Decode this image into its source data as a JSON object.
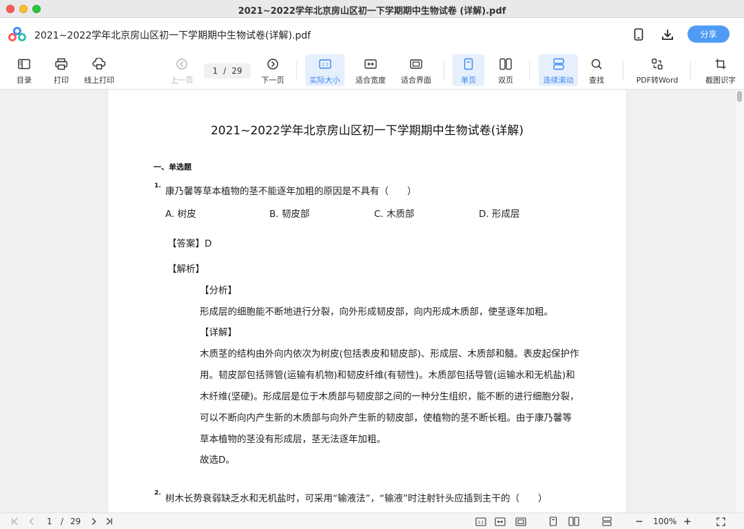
{
  "window": {
    "title": "2021~2022学年北京房山区初一下学期期中生物试卷 (详解).pdf"
  },
  "header": {
    "doc_title": "2021~2022学年北京房山区初一下学期期中生物试卷(详解).pdf",
    "share_label": "分享",
    "icons": [
      "app-logo",
      "phone-icon",
      "download-icon"
    ]
  },
  "toolbar": {
    "toc": "目录",
    "print": "打印",
    "online_print": "线上打印",
    "prev_page": "上一页",
    "current_page": "1",
    "page_sep": "/",
    "total_pages": "29",
    "next_page": "下一页",
    "actual_size": "实际大小",
    "fit_width": "适合宽度",
    "fit_page": "适合界面",
    "single_page": "单页",
    "double_page": "双页",
    "continuous_scroll": "连续滚动",
    "find": "查找",
    "pdf_to_word": "PDF转Word",
    "ocr": "截图识字",
    "accent_color": "#3a86f0"
  },
  "page": {
    "title": "2021~2022学年北京房山区初一下学期期中生物试卷(详解)",
    "section": "一、单选题",
    "q1": {
      "num": "1.",
      "text": "康乃馨等草本植物的茎不能逐年加粗的原因是不具有（　　）",
      "options": [
        "A. 树皮",
        "B. 韧皮部",
        "C. 木质部",
        "D. 形成层"
      ],
      "answer": "【答案】D",
      "analysis_head": "【解析】",
      "fenxi_head": "【分析】",
      "fenxi_text": "形成层的细胞能不断地进行分裂，向外形成韧皮部，向内形成木质部，使茎逐年加粗。",
      "xiangjie_head": "【详解】",
      "xiangjie_lines": [
        "木质茎的结构由外向内依次为树皮(包括表皮和韧皮部)、形成层、木质部和髓。表皮起保护作",
        "用。韧皮部包括筛管(运输有机物)和韧皮纤维(有韧性)。木质部包括导管(运输水和无机盐)和",
        "木纤维(坚硬)。形成层是位于木质部与韧皮部之间的一种分生组织，能不断的进行细胞分裂，",
        "可以不断向内产生新的木质部与向外产生新的韧皮部，使植物的茎不断长粗。由于康乃馨等",
        "草本植物的茎没有形成层，茎无法逐年加粗。",
        "故选D。"
      ]
    },
    "q2": {
      "num": "2.",
      "text": "树木长势衰弱缺乏水和无机盐时，可采用“输液法”，“输液”时注射针头应插到主干的（　　）"
    }
  },
  "statusbar": {
    "current_page": "1",
    "page_sep": "/",
    "total_pages": "29",
    "zoom": "100%"
  }
}
